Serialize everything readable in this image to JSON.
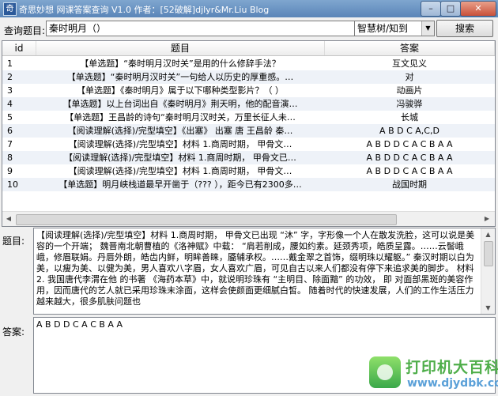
{
  "window": {
    "title": "奇思妙想 网课答案查询 V1.0 作者：[52破解]djlyr&Mr.Liu Blog",
    "icon": "app-icon",
    "min_glyph": "–",
    "max_glyph": "□",
    "close_glyph": "✕"
  },
  "search": {
    "label": "查询题目:",
    "value": "秦时明月（）",
    "source_selected": "智慧树/知到",
    "button": "搜索"
  },
  "table": {
    "headers": [
      "id",
      "题目",
      "答案"
    ],
    "rows": [
      {
        "id": "1",
        "question": "【单选题】“秦时明月汉时关”是用的什么修辞手法？",
        "answer": "互文见义"
      },
      {
        "id": "2",
        "question": "【单选题】“秦时明月汉时关”一句给人以历史的厚重感。…",
        "answer": "对"
      },
      {
        "id": "3",
        "question": "【单选题】《秦时明月》属于以下哪种类型影片？（ ）",
        "answer": "动画片"
      },
      {
        "id": "4",
        "question": "【单选题】以上台词出自《秦时明月》荆天明，他的配音演…",
        "answer": "冯骏骅"
      },
      {
        "id": "5",
        "question": "【单选题】王昌龄的诗句“秦时明月汉时关，万里长征人未…",
        "answer": "长城"
      },
      {
        "id": "6",
        "question": "【阅读理解(选择)/完型填空】《出塞》 出塞 唐 王昌龄 秦…",
        "answer": "A B D C A,C,D"
      },
      {
        "id": "7",
        "question": "【阅读理解(选择)/完型填空】材料 1.商周时期， 甲骨文…",
        "answer": "A B D D C A C B A A"
      },
      {
        "id": "8",
        "question": "【阅读理解(选择)/完型填空】材料 1.商周时期， 甲骨文已…",
        "answer": "A B D D C A C B A A"
      },
      {
        "id": "9",
        "question": "【阅读理解(选择)/完型填空】材料 1.商周时期， 甲骨文…",
        "answer": "A B D D C A C B A A"
      },
      {
        "id": "10",
        "question": "【单选题】明月峡栈道最早开凿于（??? ），距今已有2300多…",
        "answer": "战国时期"
      }
    ]
  },
  "detail": {
    "question_label": "题目:",
    "question_text": "【阅读理解(选择)/完型填空】材料 1.商周时期， 甲骨文已出现 “沐” 字，字形像一个人在散发洗脸，这可以说是美容的一个开端； 魏晋南北朝曹植的《洛神赋》中载： “肩若削成，腰如约素。延颈秀项，皓质呈露。……云髻峨峨，修眉联娟。丹唇外朗，皓齿内鲜，明眸善睐，靥辅承权。……戴金翠之首饰，缀明珠以耀躯。” 秦汉时期以白为美，以瘦为美、以健为美，男人喜欢八字眉，女人喜欢广眉，可见自古以来人们都没有停下来追求美的脚步。 材料 2. 我国唐代李渭在他 的书著 《海药本草》中，就说明珍珠有 “主明目、除面黯” 的功效， 即 对面部黑斑的美容作用，因而唐代的艺人就已采用珍珠末涂面，这样会使颜面更细腻白皙。 随着时代的快速发展，人们的工作生活压力越来越大，很多肌肤问题也",
    "answer_label": "答案:",
    "answer_text": "A B D D C A C B A A"
  },
  "watermark": {
    "line1": "打印机大百科",
    "line2": "www.djydbk.com"
  }
}
